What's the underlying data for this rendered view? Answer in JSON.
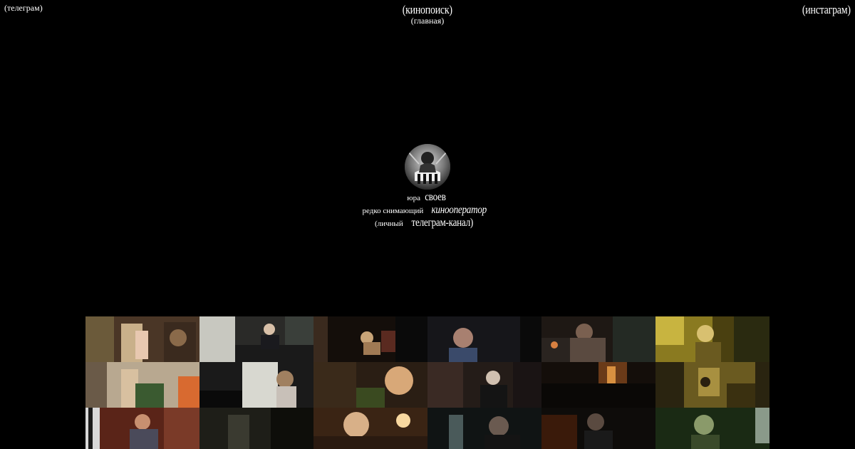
{
  "nav": {
    "telegram": "(телеграм)",
    "kinopoisk": "(кинопоиск)",
    "home": "(главная)",
    "instagram": "(инстаграм)"
  },
  "profile": {
    "first_name": "юра",
    "last_name": "своев",
    "tagline_prefix": "редко снимающий",
    "tagline_role": "кинооператор",
    "channel_prefix": "(личный",
    "channel_link": "телеграм-канал)"
  },
  "gallery": {
    "stills": [
      {
        "subject": "film-still-room-doorway"
      },
      {
        "subject": "film-still-man-desk"
      },
      {
        "subject": "film-still-bear-lamp"
      },
      {
        "subject": "film-still-girl-night"
      },
      {
        "subject": "film-still-couple-kitchen"
      },
      {
        "subject": "film-still-green-light"
      },
      {
        "subject": "film-still-woman-apron"
      },
      {
        "subject": "film-still-girl-piano"
      },
      {
        "subject": "film-still-woman-plant"
      },
      {
        "subject": "film-still-man-suit"
      },
      {
        "subject": "film-still-dark-room"
      },
      {
        "subject": "film-still-man-window"
      },
      {
        "subject": "film-still-man-carpet"
      },
      {
        "subject": "film-still-woman-hall"
      },
      {
        "subject": "film-still-women-lamp"
      },
      {
        "subject": "film-still-man-dark"
      },
      {
        "subject": "film-still-boy-night"
      },
      {
        "subject": "film-still-boy-green"
      }
    ]
  }
}
